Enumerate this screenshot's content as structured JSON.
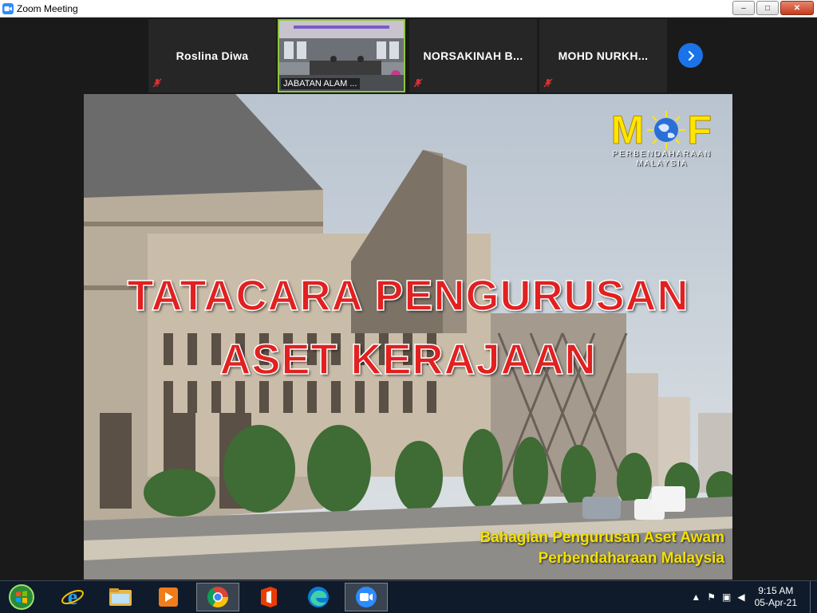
{
  "window": {
    "title": "Zoom Meeting",
    "controls": {
      "minimize": "–",
      "maximize": "□",
      "close": "✕"
    }
  },
  "participants": [
    {
      "name": "Roslina Diwa",
      "muted": true,
      "video": false
    },
    {
      "name": "JABATAN ALAM ...",
      "muted": false,
      "video": true
    },
    {
      "name": "NORSAKINAH  B...",
      "muted": true,
      "video": false
    },
    {
      "name": "MOHD  NURKH...",
      "muted": true,
      "video": false
    }
  ],
  "slide": {
    "title_line1": "TATACARA PENGURUSAN",
    "title_line2": "ASET KERAJAAN",
    "subtitle_line1": "Bahagian Pengurusan Aset Awam",
    "subtitle_line2": "Perbendaharaan Malaysia",
    "logo_left": "M",
    "logo_right": "F",
    "logo_org_line1": "PERBENDAHARAAN",
    "logo_org_line2": "MALAYSIA"
  },
  "taskbar": {
    "items": [
      "start-button",
      "internet-explorer-icon",
      "file-explorer-icon",
      "media-player-icon",
      "chrome-icon",
      "office-icon",
      "edge-icon",
      "zoom-icon"
    ],
    "time": "9:15 AM",
    "date": "05-Apr-21"
  },
  "colors": {
    "accent": "#1a73e8",
    "slide_title": "#e22020",
    "slide_subtitle": "#f5e100",
    "mof_yellow": "#ffe600",
    "active_speaker": "#8dc63f"
  }
}
